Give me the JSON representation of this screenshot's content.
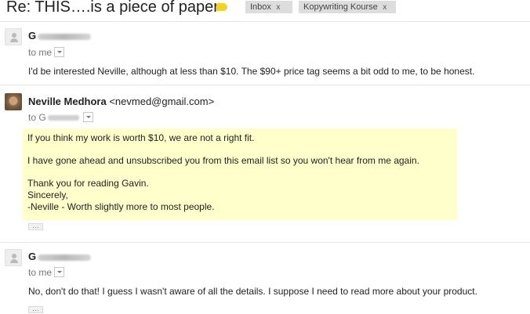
{
  "thread": {
    "subject": "Re: THIS….is a piece of paper",
    "labels": [
      {
        "name": "Inbox",
        "close": "x"
      },
      {
        "name": "Kopywriting Kourse",
        "close": "x"
      }
    ]
  },
  "messages": [
    {
      "sender_initial": "G",
      "recipient_prefix": "to me",
      "body": "I'd be interested Neville, although at less than $10.  The $90+ price tag seems a bit odd to me, to be honest."
    },
    {
      "sender_name": "Neville Medhora",
      "sender_email": "<nevmed@gmail.com>",
      "recipient_prefix": "to",
      "recipient_initial": "G",
      "paragraphs": [
        "If you think my work is worth $10, we are not a right fit.",
        "I have gone ahead and unsubscribed you from this email list so you won't hear from me again.",
        "Thank you for reading Gavin.",
        "Sincerely,",
        "-Neville - Worth slightly more to most people."
      ],
      "ellipsis": "…"
    },
    {
      "sender_initial": "G",
      "recipient_prefix": "to me",
      "body": "No, don't do that!  I guess I wasn't aware of all the details.  I suppose I need to read more about your product.",
      "ellipsis": "…"
    }
  ],
  "colors": {
    "quote_background": "#ffffcc",
    "label_chip": "#dddddd",
    "tag_icon": "#f4d31f"
  },
  "icons": [
    "tag-icon",
    "default-avatar-icon",
    "chevron-down-icon",
    "close-icon"
  ]
}
